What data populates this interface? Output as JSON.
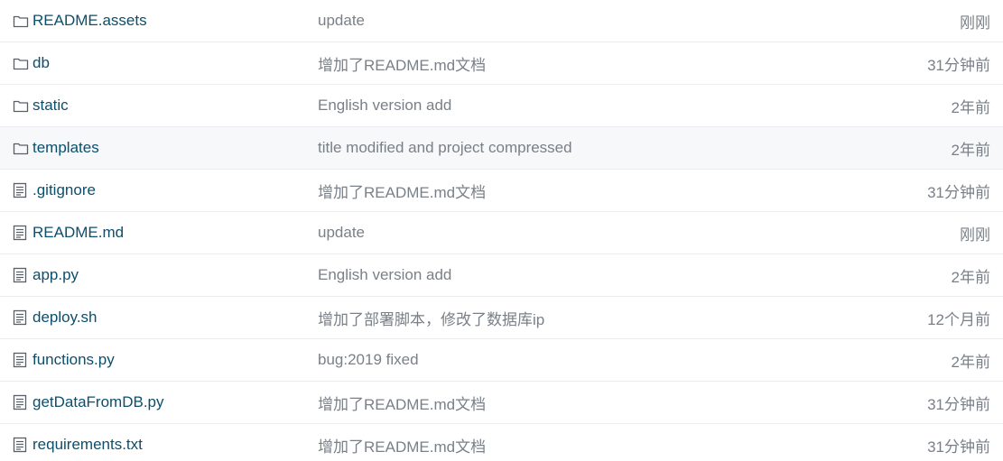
{
  "files": [
    {
      "icon": "folder-icon",
      "name": "README.assets",
      "message": "update",
      "time": "刚刚"
    },
    {
      "icon": "folder-icon",
      "name": "db",
      "message": "增加了README.md文档",
      "time": "31分钟前"
    },
    {
      "icon": "folder-icon",
      "name": "static",
      "message": "English version add",
      "time": "2年前"
    },
    {
      "icon": "folder-icon",
      "name": "templates",
      "message": "title modified and project compressed",
      "time": "2年前"
    },
    {
      "icon": "file-icon",
      "name": ".gitignore",
      "message": "增加了README.md文档",
      "time": "31分钟前"
    },
    {
      "icon": "file-icon",
      "name": "README.md",
      "message": "update",
      "time": "刚刚"
    },
    {
      "icon": "file-icon",
      "name": "app.py",
      "message": "English version add",
      "time": "2年前"
    },
    {
      "icon": "file-icon",
      "name": "deploy.sh",
      "message": "增加了部署脚本，修改了数据库ip",
      "time": "12个月前"
    },
    {
      "icon": "file-icon",
      "name": "functions.py",
      "message": "bug:2019 fixed",
      "time": "2年前"
    },
    {
      "icon": "file-icon",
      "name": "getDataFromDB.py",
      "message": "增加了README.md文档",
      "time": "31分钟前"
    },
    {
      "icon": "file-icon",
      "name": "requirements.txt",
      "message": "增加了README.md文档",
      "time": "31分钟前"
    }
  ],
  "colors": {
    "link": "#0b4f6c",
    "muted": "#7a8088",
    "border": "#eaecef",
    "hover_row": "#f6f8fa"
  }
}
